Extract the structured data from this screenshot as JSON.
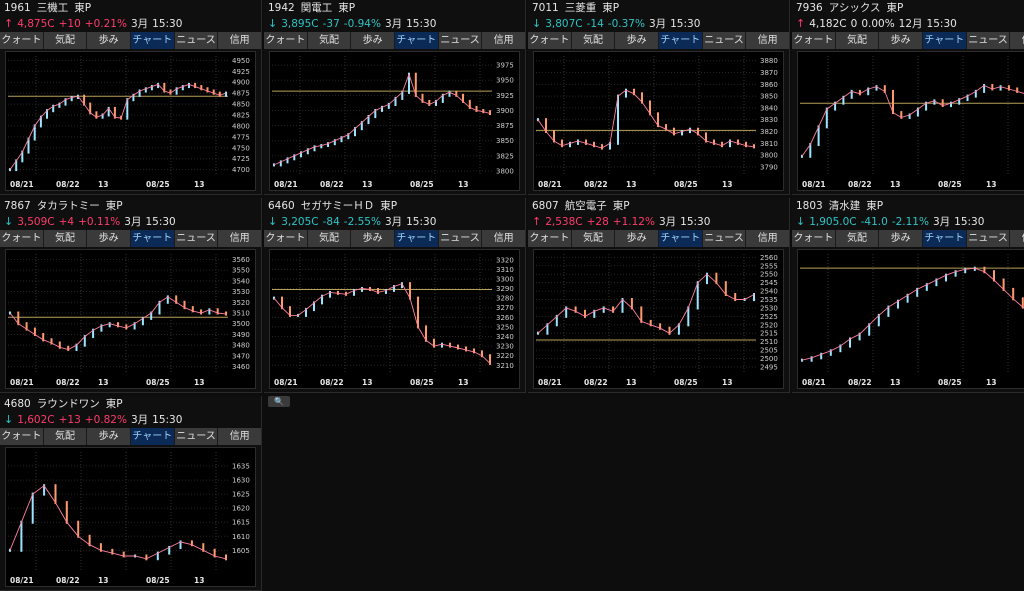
{
  "tabs": [
    "クォート",
    "気配",
    "歩み",
    "チャート",
    "ニュース",
    "信用"
  ],
  "active_tab": "チャート",
  "xlabels": [
    "08/21",
    "08/22",
    "13",
    "08/25",
    "13"
  ],
  "colors": {
    "up": "#ff3b6b",
    "down": "#2ec4c4",
    "price_line": "#b8a15a",
    "ma": "#ff7f9f",
    "candle_pos": "#9be5ff",
    "candle_neg": "#ff9b6b"
  },
  "panels": [
    {
      "code": "1961",
      "name": "三機工",
      "market": "東P",
      "dir": "up",
      "price": "4,875C",
      "change": "+10",
      "pct": "+0.21%",
      "month": "3月",
      "time": "15:30",
      "chart_data": {
        "type": "line",
        "yticks": [
          4950,
          4925,
          4900,
          4875,
          4850,
          4825,
          4800,
          4775,
          4750,
          4725,
          4700
        ],
        "ylim": [
          4690,
          4960
        ],
        "ref": 4868,
        "values": [
          4700,
          4720,
          4740,
          4770,
          4800,
          4820,
          4835,
          4845,
          4850,
          4860,
          4865,
          4868,
          4850,
          4830,
          4820,
          4825,
          4840,
          4820,
          4818,
          4860,
          4870,
          4880,
          4885,
          4890,
          4895,
          4880,
          4875,
          4885,
          4890,
          4895,
          4890,
          4885,
          4880,
          4875,
          4870,
          4875
        ]
      }
    },
    {
      "code": "1942",
      "name": "関電工",
      "market": "東P",
      "dir": "down",
      "price": "3,895C",
      "change": "-37",
      "pct": "-0.94%",
      "month": "3月",
      "time": "15:30",
      "chart_data": {
        "type": "line",
        "yticks": [
          3975,
          3950,
          3925,
          3900,
          3875,
          3850,
          3825,
          3800
        ],
        "ylim": [
          3795,
          3990
        ],
        "ref": 3932,
        "values": [
          3810,
          3815,
          3820,
          3825,
          3830,
          3835,
          3840,
          3842,
          3845,
          3850,
          3855,
          3860,
          3870,
          3880,
          3890,
          3900,
          3905,
          3910,
          3920,
          3930,
          3960,
          3925,
          3915,
          3910,
          3915,
          3925,
          3930,
          3925,
          3915,
          3905,
          3900,
          3898,
          3895
        ]
      }
    },
    {
      "code": "7011",
      "name": "三菱重",
      "market": "東P",
      "dir": "down",
      "price": "3,807C",
      "change": "-14",
      "pct": "-0.37%",
      "month": "3月",
      "time": "15:30",
      "chart_data": {
        "type": "line",
        "yticks": [
          3880,
          3870,
          3860,
          3850,
          3840,
          3830,
          3820,
          3810,
          3800,
          3790
        ],
        "ylim": [
          3784,
          3884
        ],
        "ref": 3821,
        "values": [
          3830,
          3820,
          3812,
          3808,
          3810,
          3812,
          3810,
          3808,
          3806,
          3810,
          3850,
          3855,
          3852,
          3845,
          3835,
          3825,
          3822,
          3818,
          3820,
          3822,
          3818,
          3812,
          3810,
          3808,
          3812,
          3810,
          3808,
          3807
        ]
      }
    },
    {
      "code": "7936",
      "name": "アシックス",
      "market": "東P",
      "dir": "up",
      "price": "4,182C",
      "change": "0",
      "pct": "0.00%",
      "month": "12月",
      "time": "15:30",
      "chart_data": {
        "type": "line",
        "yticks": [],
        "ylim": [
          0,
          100
        ],
        "ref": 60,
        "values": [
          15,
          25,
          40,
          55,
          60,
          65,
          70,
          68,
          72,
          74,
          70,
          52,
          48,
          50,
          55,
          60,
          62,
          58,
          60,
          63,
          66,
          70,
          75,
          72,
          74,
          72,
          70,
          68,
          65,
          64
        ]
      }
    },
    {
      "code": "7867",
      "name": "タカラトミー",
      "market": "東P",
      "dir": "down",
      "price": "3,509C",
      "change": "+4",
      "pct": "+0.11%",
      "month": "3月",
      "time": "15:30",
      "chart_data": {
        "type": "line",
        "yticks": [
          3560,
          3550,
          3540,
          3530,
          3520,
          3510,
          3500,
          3490,
          3480,
          3470,
          3460
        ],
        "ylim": [
          3455,
          3565
        ],
        "ref": 3506,
        "values": [
          3510,
          3500,
          3495,
          3490,
          3485,
          3482,
          3478,
          3476,
          3480,
          3488,
          3494,
          3498,
          3500,
          3498,
          3496,
          3500,
          3505,
          3510,
          3520,
          3525,
          3520,
          3515,
          3512,
          3510,
          3513,
          3510,
          3509
        ]
      }
    },
    {
      "code": "6460",
      "name": "セガサミーＨＤ",
      "market": "東P",
      "dir": "down",
      "price": "3,205C",
      "change": "-84",
      "pct": "-2.55%",
      "month": "3月",
      "time": "15:30",
      "chart_data": {
        "type": "line",
        "yticks": [
          3320,
          3310,
          3300,
          3290,
          3280,
          3270,
          3260,
          3250,
          3240,
          3230,
          3220,
          3210
        ],
        "ylim": [
          3203,
          3326
        ],
        "ref": 3289,
        "values": [
          3280,
          3270,
          3262,
          3262,
          3268,
          3275,
          3282,
          3286,
          3285,
          3284,
          3288,
          3290,
          3289,
          3286,
          3288,
          3292,
          3295,
          3280,
          3250,
          3236,
          3230,
          3232,
          3230,
          3228,
          3226,
          3224,
          3220,
          3212
        ]
      }
    },
    {
      "code": "6807",
      "name": "航空電子",
      "market": "東P",
      "dir": "up",
      "price": "2,538C",
      "change": "+28",
      "pct": "+1.12%",
      "month": "3月",
      "time": "15:30",
      "chart_data": {
        "type": "line",
        "yticks": [
          2560,
          2555,
          2550,
          2545,
          2540,
          2535,
          2530,
          2525,
          2520,
          2515,
          2510,
          2505,
          2500,
          2495
        ],
        "ylim": [
          2492,
          2562
        ],
        "ref": 2511,
        "values": [
          2515,
          2520,
          2525,
          2530,
          2528,
          2525,
          2528,
          2530,
          2528,
          2535,
          2530,
          2522,
          2520,
          2518,
          2515,
          2520,
          2530,
          2545,
          2550,
          2545,
          2538,
          2535,
          2535,
          2538
        ]
      }
    },
    {
      "code": "1803",
      "name": "清水建",
      "market": "東P",
      "dir": "down",
      "price": "1,905.0C",
      "change": "-41.0",
      "pct": "-2.11%",
      "month": "3月",
      "time": "15:30",
      "chart_data": {
        "type": "line",
        "yticks": [],
        "ylim": [
          0,
          100
        ],
        "ref": 88,
        "values": [
          10,
          12,
          15,
          18,
          22,
          28,
          32,
          40,
          48,
          55,
          60,
          65,
          70,
          74,
          78,
          82,
          85,
          87,
          88,
          85,
          78,
          70,
          62,
          55,
          52,
          50
        ]
      }
    },
    {
      "code": "4680",
      "name": "ラウンドワン",
      "market": "東P",
      "dir": "down",
      "price": "1,602C",
      "change": "+13",
      "pct": "+0.82%",
      "month": "3月",
      "time": "15:30",
      "chart_data": {
        "type": "line",
        "yticks": [
          1635,
          1630,
          1625,
          1620,
          1615,
          1610,
          1605
        ],
        "ylim": [
          1598,
          1640
        ],
        "ref": null,
        "values": [
          1605,
          1615,
          1625,
          1628,
          1622,
          1615,
          1610,
          1607,
          1605,
          1604,
          1603,
          1603,
          1602,
          1604,
          1606,
          1608,
          1607,
          1605,
          1603,
          1602
        ]
      }
    }
  ]
}
